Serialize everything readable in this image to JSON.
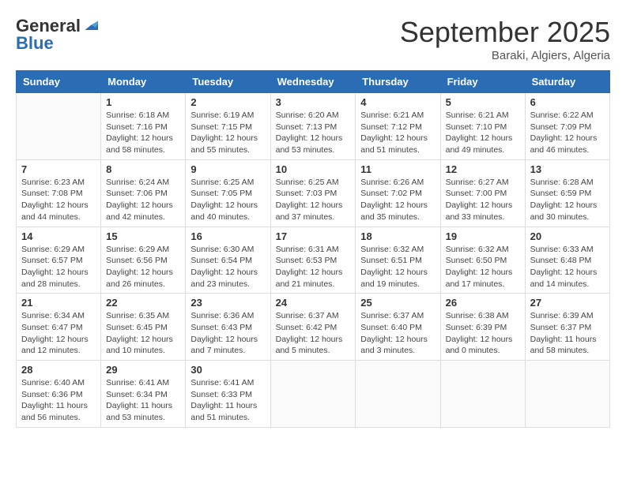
{
  "logo": {
    "general": "General",
    "blue": "Blue"
  },
  "title": "September 2025",
  "subtitle": "Baraki, Algiers, Algeria",
  "days_of_week": [
    "Sunday",
    "Monday",
    "Tuesday",
    "Wednesday",
    "Thursday",
    "Friday",
    "Saturday"
  ],
  "weeks": [
    [
      {
        "day": "",
        "info": ""
      },
      {
        "day": "1",
        "info": "Sunrise: 6:18 AM\nSunset: 7:16 PM\nDaylight: 12 hours\nand 58 minutes."
      },
      {
        "day": "2",
        "info": "Sunrise: 6:19 AM\nSunset: 7:15 PM\nDaylight: 12 hours\nand 55 minutes."
      },
      {
        "day": "3",
        "info": "Sunrise: 6:20 AM\nSunset: 7:13 PM\nDaylight: 12 hours\nand 53 minutes."
      },
      {
        "day": "4",
        "info": "Sunrise: 6:21 AM\nSunset: 7:12 PM\nDaylight: 12 hours\nand 51 minutes."
      },
      {
        "day": "5",
        "info": "Sunrise: 6:21 AM\nSunset: 7:10 PM\nDaylight: 12 hours\nand 49 minutes."
      },
      {
        "day": "6",
        "info": "Sunrise: 6:22 AM\nSunset: 7:09 PM\nDaylight: 12 hours\nand 46 minutes."
      }
    ],
    [
      {
        "day": "7",
        "info": "Sunrise: 6:23 AM\nSunset: 7:08 PM\nDaylight: 12 hours\nand 44 minutes."
      },
      {
        "day": "8",
        "info": "Sunrise: 6:24 AM\nSunset: 7:06 PM\nDaylight: 12 hours\nand 42 minutes."
      },
      {
        "day": "9",
        "info": "Sunrise: 6:25 AM\nSunset: 7:05 PM\nDaylight: 12 hours\nand 40 minutes."
      },
      {
        "day": "10",
        "info": "Sunrise: 6:25 AM\nSunset: 7:03 PM\nDaylight: 12 hours\nand 37 minutes."
      },
      {
        "day": "11",
        "info": "Sunrise: 6:26 AM\nSunset: 7:02 PM\nDaylight: 12 hours\nand 35 minutes."
      },
      {
        "day": "12",
        "info": "Sunrise: 6:27 AM\nSunset: 7:00 PM\nDaylight: 12 hours\nand 33 minutes."
      },
      {
        "day": "13",
        "info": "Sunrise: 6:28 AM\nSunset: 6:59 PM\nDaylight: 12 hours\nand 30 minutes."
      }
    ],
    [
      {
        "day": "14",
        "info": "Sunrise: 6:29 AM\nSunset: 6:57 PM\nDaylight: 12 hours\nand 28 minutes."
      },
      {
        "day": "15",
        "info": "Sunrise: 6:29 AM\nSunset: 6:56 PM\nDaylight: 12 hours\nand 26 minutes."
      },
      {
        "day": "16",
        "info": "Sunrise: 6:30 AM\nSunset: 6:54 PM\nDaylight: 12 hours\nand 23 minutes."
      },
      {
        "day": "17",
        "info": "Sunrise: 6:31 AM\nSunset: 6:53 PM\nDaylight: 12 hours\nand 21 minutes."
      },
      {
        "day": "18",
        "info": "Sunrise: 6:32 AM\nSunset: 6:51 PM\nDaylight: 12 hours\nand 19 minutes."
      },
      {
        "day": "19",
        "info": "Sunrise: 6:32 AM\nSunset: 6:50 PM\nDaylight: 12 hours\nand 17 minutes."
      },
      {
        "day": "20",
        "info": "Sunrise: 6:33 AM\nSunset: 6:48 PM\nDaylight: 12 hours\nand 14 minutes."
      }
    ],
    [
      {
        "day": "21",
        "info": "Sunrise: 6:34 AM\nSunset: 6:47 PM\nDaylight: 12 hours\nand 12 minutes."
      },
      {
        "day": "22",
        "info": "Sunrise: 6:35 AM\nSunset: 6:45 PM\nDaylight: 12 hours\nand 10 minutes."
      },
      {
        "day": "23",
        "info": "Sunrise: 6:36 AM\nSunset: 6:43 PM\nDaylight: 12 hours\nand 7 minutes."
      },
      {
        "day": "24",
        "info": "Sunrise: 6:37 AM\nSunset: 6:42 PM\nDaylight: 12 hours\nand 5 minutes."
      },
      {
        "day": "25",
        "info": "Sunrise: 6:37 AM\nSunset: 6:40 PM\nDaylight: 12 hours\nand 3 minutes."
      },
      {
        "day": "26",
        "info": "Sunrise: 6:38 AM\nSunset: 6:39 PM\nDaylight: 12 hours\nand 0 minutes."
      },
      {
        "day": "27",
        "info": "Sunrise: 6:39 AM\nSunset: 6:37 PM\nDaylight: 11 hours\nand 58 minutes."
      }
    ],
    [
      {
        "day": "28",
        "info": "Sunrise: 6:40 AM\nSunset: 6:36 PM\nDaylight: 11 hours\nand 56 minutes."
      },
      {
        "day": "29",
        "info": "Sunrise: 6:41 AM\nSunset: 6:34 PM\nDaylight: 11 hours\nand 53 minutes."
      },
      {
        "day": "30",
        "info": "Sunrise: 6:41 AM\nSunset: 6:33 PM\nDaylight: 11 hours\nand 51 minutes."
      },
      {
        "day": "",
        "info": ""
      },
      {
        "day": "",
        "info": ""
      },
      {
        "day": "",
        "info": ""
      },
      {
        "day": "",
        "info": ""
      }
    ]
  ]
}
